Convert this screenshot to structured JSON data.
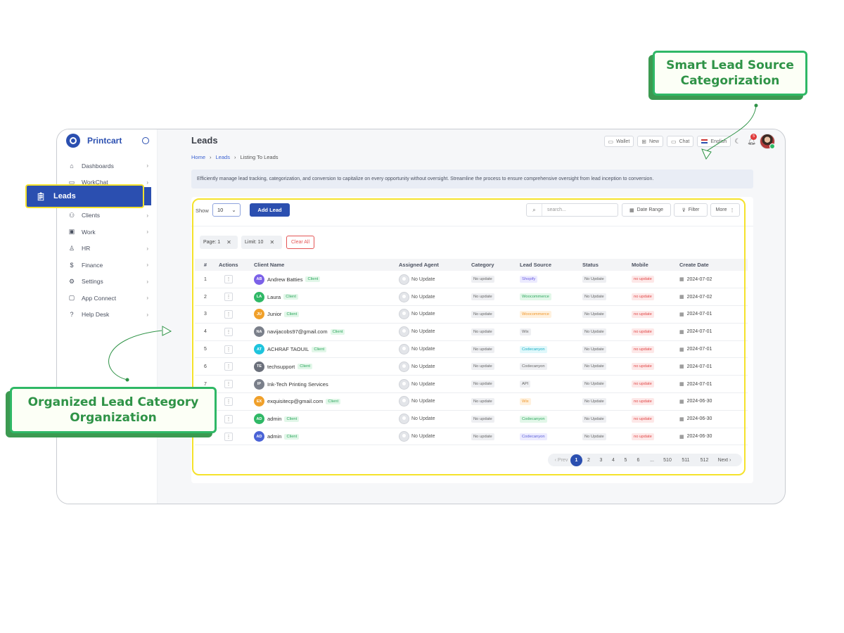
{
  "callouts": {
    "top": "Smart Lead Source Categorization",
    "left": "Organized Lead Category Organization"
  },
  "brand": {
    "name": "Printcart"
  },
  "sidebar": {
    "items": [
      {
        "label": "Dashboards",
        "icon": "home-icon"
      },
      {
        "label": "WorkChat",
        "icon": "chat-icon"
      },
      {
        "label": "Leads",
        "icon": "clipboard-icon"
      },
      {
        "label": "Clients",
        "icon": "users-icon"
      },
      {
        "label": "Work",
        "icon": "briefcase-icon"
      },
      {
        "label": "HR",
        "icon": "user-icon"
      },
      {
        "label": "Finance",
        "icon": "dollar-icon"
      },
      {
        "label": "Settings",
        "icon": "gear-icon"
      },
      {
        "label": "App Connect",
        "icon": "square-icon"
      },
      {
        "label": "Help Desk",
        "icon": "help-icon"
      }
    ],
    "active": "Leads"
  },
  "header": {
    "title": "Leads",
    "breadcrumb": [
      "Home",
      "Leads",
      "Listing To Leads"
    ],
    "wallet": "Wallet",
    "new": "New",
    "chat": "Chat",
    "language": "English",
    "notifications": "5"
  },
  "banner": "Efficiently manage lead tracking, categorization, and conversion to capitalize on every opportunity without oversight. Streamline the process to ensure comprehensive oversight from lead inception to conversion.",
  "controls": {
    "show_label": "Show",
    "show_value": "10",
    "add_lead": "Add Lead",
    "search_placeholder": "search...",
    "date_range": "Date Range",
    "filter": "Filter",
    "more": "More"
  },
  "chips": {
    "page": "Page: 1",
    "limit": "Limit: 10",
    "clear_all": "Clear All"
  },
  "table": {
    "columns": [
      "#",
      "Actions",
      "Client Name",
      "Assigned Agent",
      "Category",
      "Lead Source",
      "Status",
      "Mobile",
      "Create Date"
    ],
    "rows": [
      {
        "num": "1",
        "initials": "AB",
        "avatar_color": "#7b61e8",
        "name": "Andrew Batties",
        "tag": "Client",
        "agent": "No Update",
        "category": "No update",
        "source": "Shopify",
        "source_bg": "#ecebff",
        "source_fg": "#6a5be0",
        "status": "No Update",
        "mobile": "no update",
        "date": "2024-07-02"
      },
      {
        "num": "2",
        "initials": "LA",
        "avatar_color": "#2fb866",
        "name": "Laura",
        "tag": "Client",
        "agent": "No Update",
        "category": "No update",
        "source": "Woocommerce",
        "source_bg": "#e2f7e9",
        "source_fg": "#2fa85f",
        "status": "No Update",
        "mobile": "no update",
        "date": "2024-07-02"
      },
      {
        "num": "3",
        "initials": "JU",
        "avatar_color": "#f0a02a",
        "name": "Junior",
        "tag": "Client",
        "agent": "No Update",
        "category": "No update",
        "source": "Woocommerce",
        "source_bg": "#fff1de",
        "source_fg": "#f0972a",
        "status": "No Update",
        "mobile": "no update",
        "date": "2024-07-01"
      },
      {
        "num": "4",
        "initials": "NA",
        "avatar_color": "#7a7f8a",
        "name": "navijacobs97@gmail.com",
        "tag": "Client",
        "agent": "No Update",
        "category": "No update",
        "source": "Wix",
        "source_bg": "#eeeff2",
        "source_fg": "#666666",
        "status": "No Update",
        "mobile": "no update",
        "date": "2024-07-01"
      },
      {
        "num": "5",
        "initials": "AT",
        "avatar_color": "#1ec4dd",
        "name": "ACHRAF TAOUIL",
        "tag": "Client",
        "agent": "No Update",
        "category": "No update",
        "source": "Codecanyon",
        "source_bg": "#e0f8fb",
        "source_fg": "#18aec4",
        "status": "No Update",
        "mobile": "no update",
        "date": "2024-07-01"
      },
      {
        "num": "6",
        "initials": "TE",
        "avatar_color": "#6b707b",
        "name": "techsupport",
        "tag": "Client",
        "agent": "No Update",
        "category": "No update",
        "source": "Codecanyon",
        "source_bg": "#eeeff2",
        "source_fg": "#666666",
        "status": "No Update",
        "mobile": "no update",
        "date": "2024-07-01"
      },
      {
        "num": "7",
        "initials": "IP",
        "avatar_color": "#7a7f8a",
        "name": "Ink-Tech Printing Services",
        "tag": "",
        "agent": "No Update",
        "category": "No update",
        "source": "API",
        "source_bg": "#eeeff2",
        "source_fg": "#666666",
        "status": "No Update",
        "mobile": "no update",
        "date": "2024-07-01"
      },
      {
        "num": "8",
        "initials": "EX",
        "avatar_color": "#f0a02a",
        "name": "exquisitecp@gmail.com",
        "tag": "Client",
        "agent": "No Update",
        "category": "No update",
        "source": "Wix",
        "source_bg": "#fff1de",
        "source_fg": "#f0972a",
        "status": "No Update",
        "mobile": "no update",
        "date": "2024-06-30"
      },
      {
        "num": "9",
        "initials": "AD",
        "avatar_color": "#2fb866",
        "name": "admin",
        "tag": "Client",
        "agent": "No Update",
        "category": "No update",
        "source": "Codecanyon",
        "source_bg": "#e2f7e9",
        "source_fg": "#2fa85f",
        "status": "No Update",
        "mobile": "no update",
        "date": "2024-06-30"
      },
      {
        "num": "10",
        "initials": "AD",
        "avatar_color": "#4a63d6",
        "name": "admin",
        "tag": "Client",
        "agent": "No Update",
        "category": "No update",
        "source": "Codecanyon",
        "source_bg": "#ecebff",
        "source_fg": "#5b5fd6",
        "status": "No Update",
        "mobile": "no update",
        "date": "2024-06-30"
      }
    ]
  },
  "pagination": {
    "prev": "‹ Prev",
    "pages": [
      "1",
      "2",
      "3",
      "4",
      "5",
      "6",
      "...",
      "510",
      "511",
      "512"
    ],
    "current": "1",
    "next": "Next ›"
  },
  "colors": {
    "accent": "#2b4fb0",
    "highlight": "#f5e22b",
    "callout_green": "#2fb866"
  }
}
